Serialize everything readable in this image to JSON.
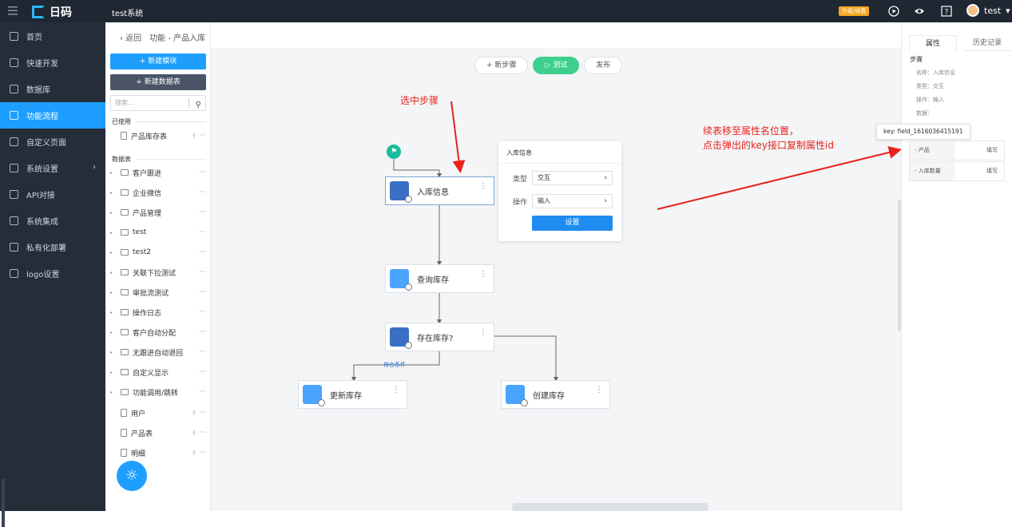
{
  "topbar": {
    "brand": "日码",
    "system": "test系统",
    "upgrade": "升级/续费",
    "user": "test"
  },
  "sidebar": {
    "items": [
      {
        "label": "首页",
        "icon": "home-icon"
      },
      {
        "label": "快速开发",
        "icon": "cube-icon"
      },
      {
        "label": "数据库",
        "icon": "database-icon"
      },
      {
        "label": "功能流程",
        "icon": "flow-icon",
        "active": true
      },
      {
        "label": "自定义页面",
        "icon": "page-icon"
      },
      {
        "label": "系统设置",
        "icon": "settings-icon",
        "arrow": "›"
      },
      {
        "label": "API对接",
        "icon": "api-icon"
      },
      {
        "label": "系统集成",
        "icon": "integration-icon"
      },
      {
        "label": "私有化部署",
        "icon": "deploy-icon"
      },
      {
        "label": "logo设置",
        "icon": "logo-icon"
      }
    ]
  },
  "breadcrumb": {
    "back": "‹ 返回",
    "title": "功能 - 产品入库"
  },
  "list": {
    "new_module": "+ 新建模块",
    "new_table": "+ 新建数据表",
    "search_placeholder": "搜索...",
    "used_label": "已使用",
    "used": [
      "产品库存表"
    ],
    "tables_label": "数据表",
    "tables": [
      "客户跟进",
      "企业微信",
      "产品管理",
      "test",
      "test2",
      "关联下拉测试",
      "审批流测试",
      "操作日志",
      "客户自动分配",
      "无跟进自动退回",
      "自定义显示",
      "功能调用/跳转"
    ],
    "docs": [
      "用户",
      "产品表",
      "明细"
    ]
  },
  "toolbar": {
    "add_step": "+ 新步骤",
    "test": "▷ 测试",
    "publish": "发布"
  },
  "nodes": {
    "n1": "入库信息",
    "n2": "查询库存",
    "n3": "存在库存?",
    "n4": "更新库存",
    "n5": "创建库存",
    "branch": "符合条件"
  },
  "popup": {
    "title": "入库信息",
    "type_label": "类型",
    "type_value": "交互",
    "op_label": "操作",
    "op_value": "输入",
    "button": "设置"
  },
  "annotations": {
    "a1": "选中步骤",
    "a2": "续表移至属性名位置，",
    "a3": "点击弹出的key接口复制属性id"
  },
  "right": {
    "tab_props": "属性",
    "tab_history": "历史记录",
    "section": "步骤",
    "name": "名称：入库信息",
    "type": "类型：交互",
    "op": "操作：输入",
    "data": "数据：",
    "tooltip": "key: field_1616036415191",
    "fields": [
      {
        "k": "- 产品",
        "v": "填写"
      },
      {
        "k": "- 入库数量",
        "v": "填写"
      }
    ]
  },
  "colors": {
    "accent": "#1e9fff",
    "annotation": "#e8231c",
    "test_button": "#3ecf8e"
  }
}
